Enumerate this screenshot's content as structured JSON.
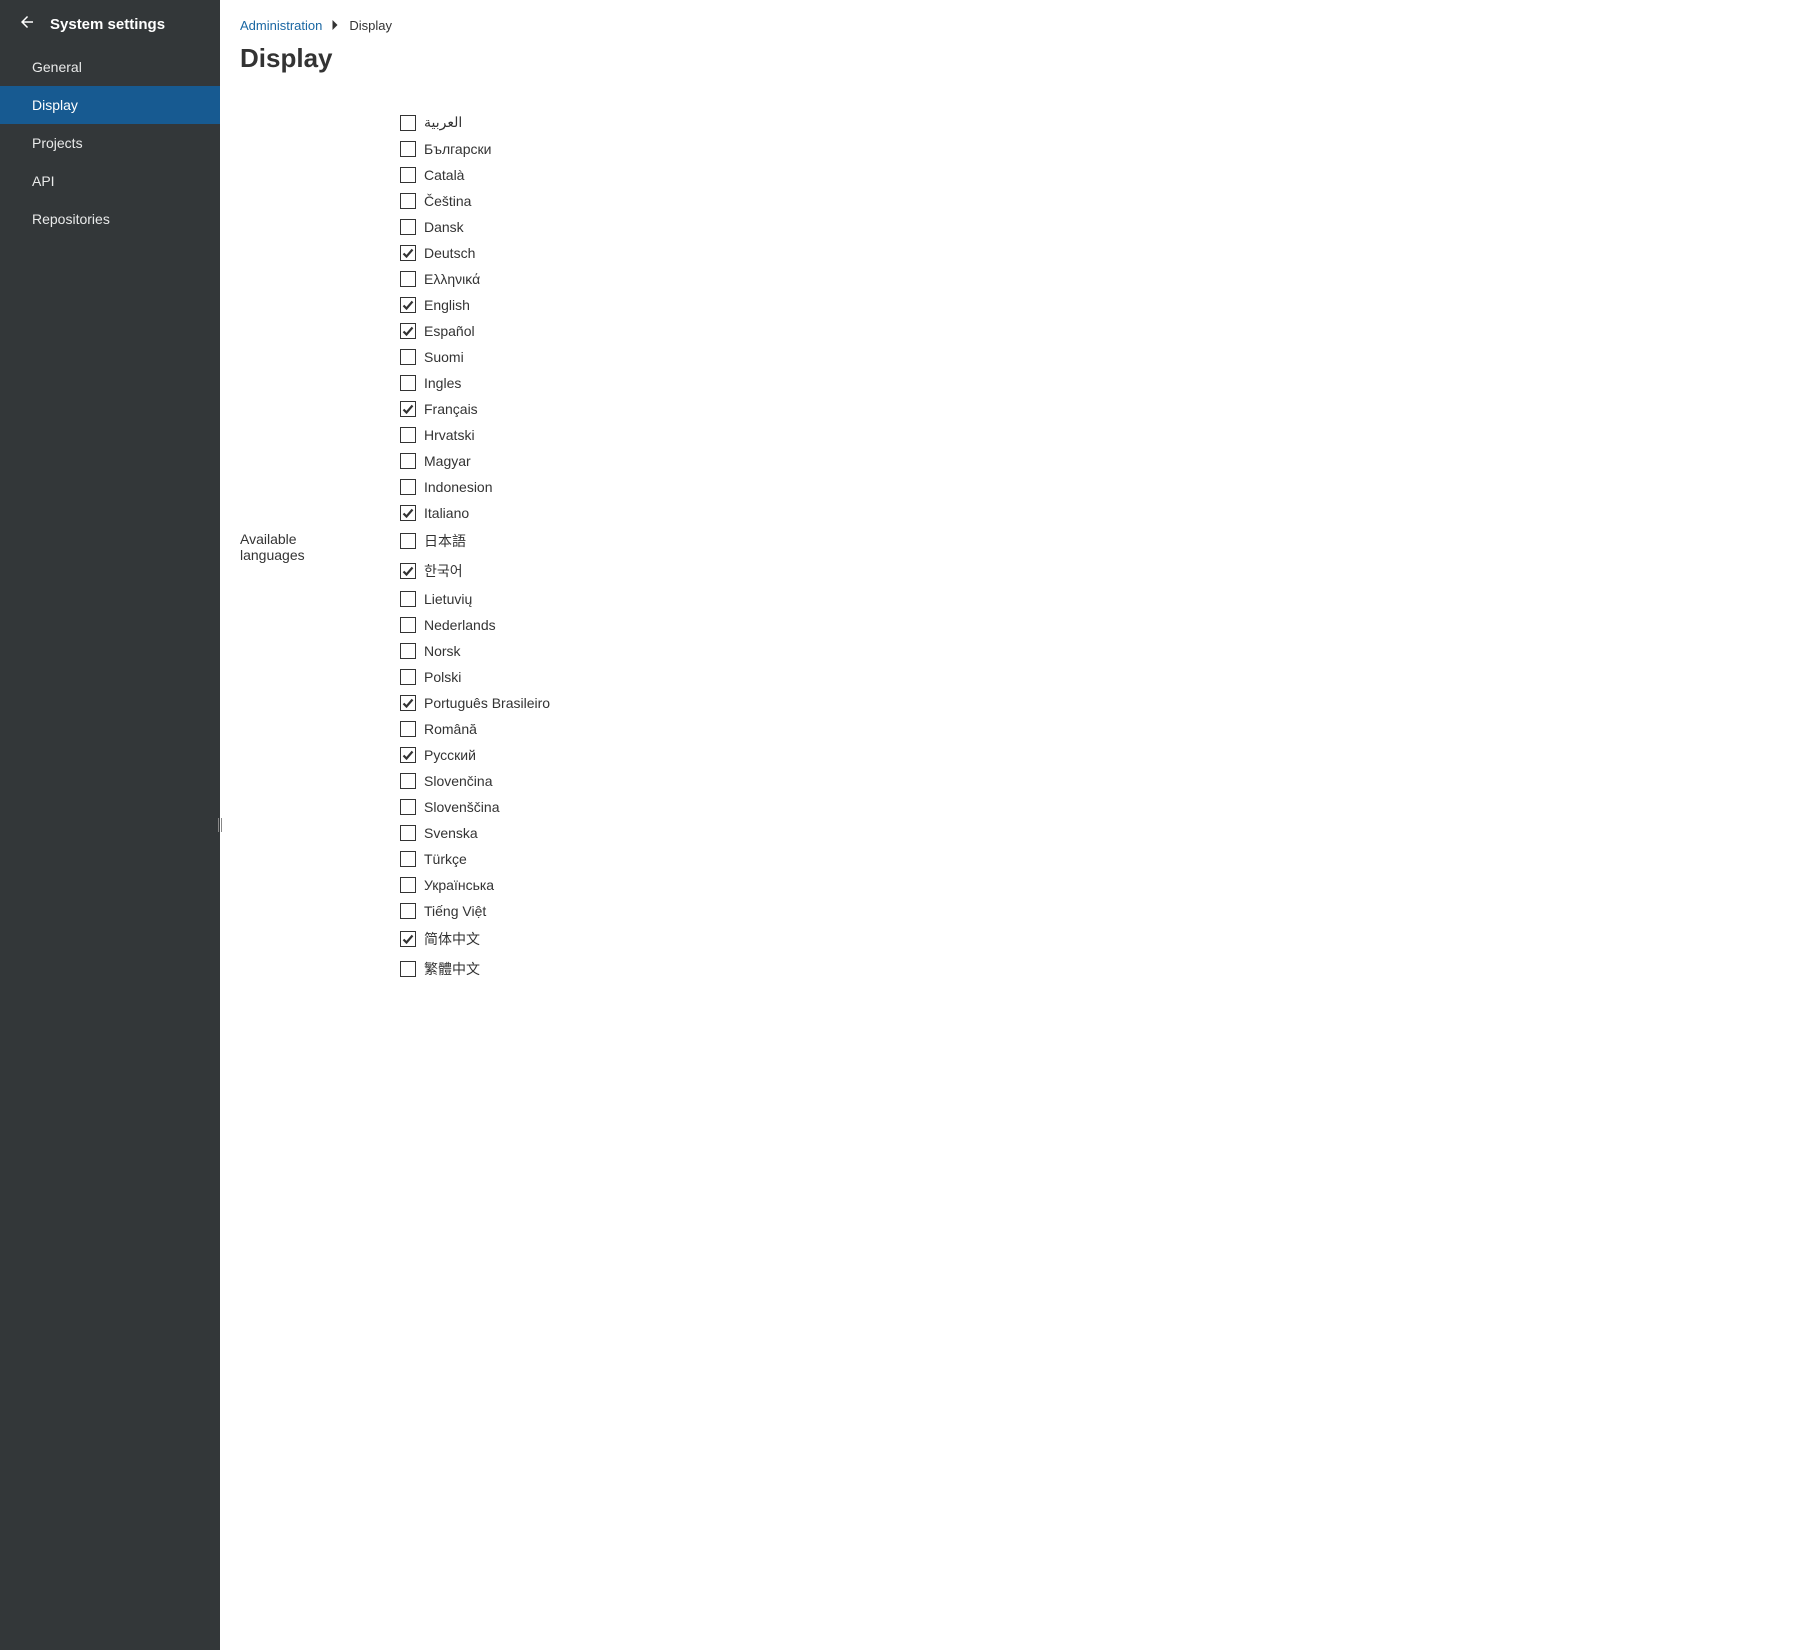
{
  "sidebar": {
    "title": "System settings",
    "items": [
      {
        "id": "general",
        "label": "General",
        "active": false
      },
      {
        "id": "display",
        "label": "Display",
        "active": true
      },
      {
        "id": "projects",
        "label": "Projects",
        "active": false
      },
      {
        "id": "api",
        "label": "API",
        "active": false
      },
      {
        "id": "repositories",
        "label": "Repositories",
        "active": false
      }
    ]
  },
  "breadcrumb": {
    "root": "Administration",
    "current": "Display"
  },
  "page": {
    "title": "Display"
  },
  "form": {
    "available_languages_label": "Available languages",
    "languages": [
      {
        "label": "العربية",
        "checked": false
      },
      {
        "label": "Български",
        "checked": false
      },
      {
        "label": "Català",
        "checked": false
      },
      {
        "label": "Čeština",
        "checked": false
      },
      {
        "label": "Dansk",
        "checked": false
      },
      {
        "label": "Deutsch",
        "checked": true
      },
      {
        "label": "Ελληνικά",
        "checked": false
      },
      {
        "label": "English",
        "checked": true
      },
      {
        "label": "Español",
        "checked": true
      },
      {
        "label": "Suomi",
        "checked": false
      },
      {
        "label": "Ingles",
        "checked": false
      },
      {
        "label": "Français",
        "checked": true
      },
      {
        "label": "Hrvatski",
        "checked": false
      },
      {
        "label": "Magyar",
        "checked": false
      },
      {
        "label": "Indonesion",
        "checked": false
      },
      {
        "label": "Italiano",
        "checked": true
      },
      {
        "label": "日本語",
        "checked": false
      },
      {
        "label": "한국어",
        "checked": true
      },
      {
        "label": "Lietuvių",
        "checked": false
      },
      {
        "label": "Nederlands",
        "checked": false
      },
      {
        "label": "Norsk",
        "checked": false
      },
      {
        "label": "Polski",
        "checked": false
      },
      {
        "label": "Português Brasileiro",
        "checked": true
      },
      {
        "label": "Română",
        "checked": false
      },
      {
        "label": "Русский",
        "checked": true
      },
      {
        "label": "Slovenčina",
        "checked": false
      },
      {
        "label": "Slovenščina",
        "checked": false
      },
      {
        "label": "Svenska",
        "checked": false
      },
      {
        "label": "Türkçe",
        "checked": false
      },
      {
        "label": "Українська",
        "checked": false
      },
      {
        "label": "Tiếng Việt",
        "checked": false
      },
      {
        "label": "简体中文",
        "checked": true
      },
      {
        "label": "繁體中文",
        "checked": false
      }
    ]
  }
}
